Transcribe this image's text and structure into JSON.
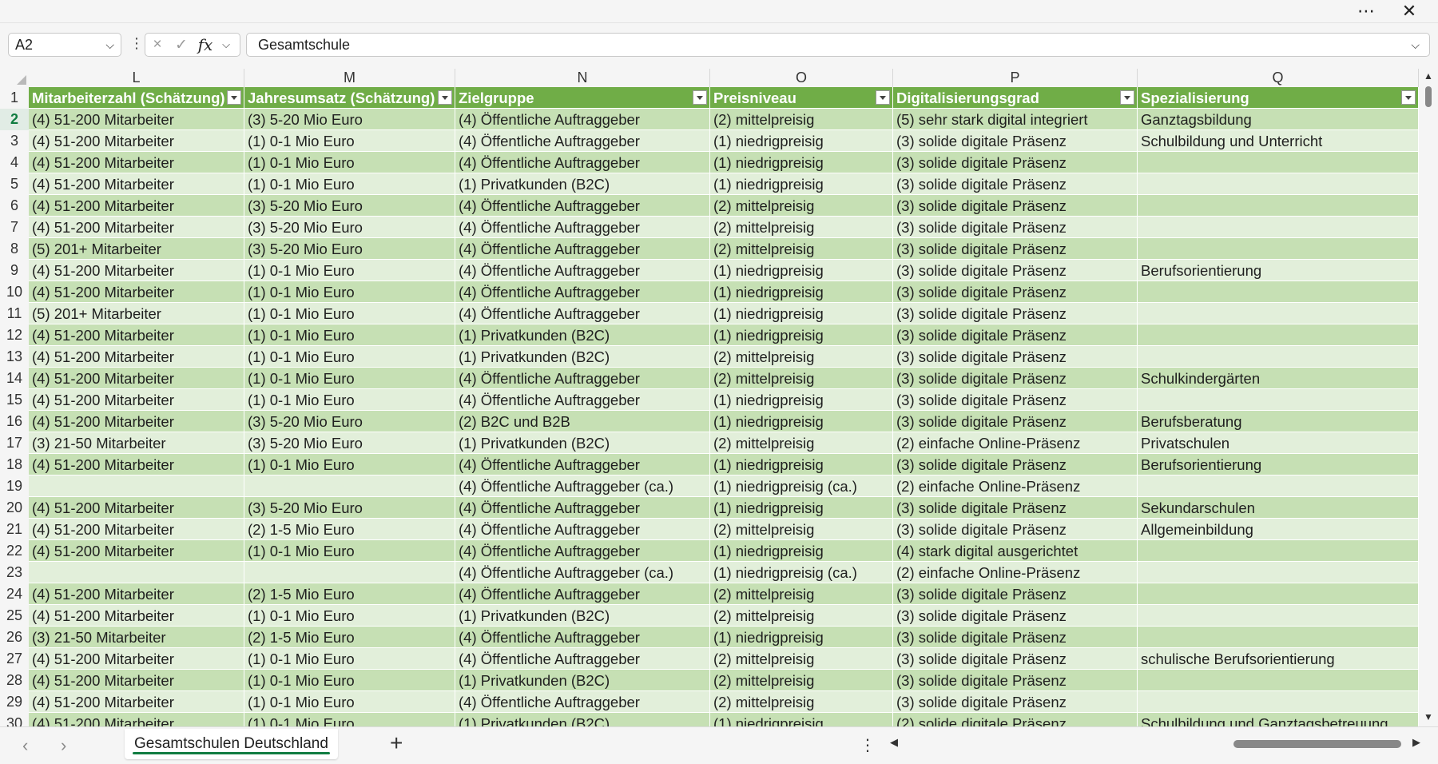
{
  "window": {
    "more_icon": "ellipsis-icon",
    "close_icon": "close-icon"
  },
  "formula_bar": {
    "name_box": "A2",
    "cancel_icon": "×",
    "enter_icon": "✓",
    "fx_label": "fx",
    "formula_value": "Gesamtschule"
  },
  "columns": [
    {
      "letter": "L",
      "header": "Mitarbeiterzahl (Schätzung)"
    },
    {
      "letter": "M",
      "header": "Jahresumsatz (Schätzung)"
    },
    {
      "letter": "N",
      "header": "Zielgruppe"
    },
    {
      "letter": "O",
      "header": "Preisniveau"
    },
    {
      "letter": "P",
      "header": "Digitalisierungsgrad"
    },
    {
      "letter": "Q",
      "header": "Spezialisierung"
    }
  ],
  "header_row_number": "1",
  "rows": [
    {
      "n": "2",
      "cells": [
        "(4) 51-200 Mitarbeiter",
        "(3) 5-20 Mio Euro",
        "(4) Öffentliche Auftraggeber",
        "(2) mittelpreisig",
        "(5) sehr stark digital integriert",
        "Ganztagsbildung"
      ]
    },
    {
      "n": "3",
      "cells": [
        "(4) 51-200 Mitarbeiter",
        "(1) 0-1 Mio Euro",
        "(4) Öffentliche Auftraggeber",
        "(1) niedrigpreisig",
        "(3) solide digitale Präsenz",
        "Schulbildung und Unterricht"
      ]
    },
    {
      "n": "4",
      "cells": [
        "(4) 51-200 Mitarbeiter",
        "(1) 0-1 Mio Euro",
        "(4) Öffentliche Auftraggeber",
        "(1) niedrigpreisig",
        "(3) solide digitale Präsenz",
        ""
      ]
    },
    {
      "n": "5",
      "cells": [
        "(4) 51-200 Mitarbeiter",
        "(1) 0-1 Mio Euro",
        "(1) Privatkunden (B2C)",
        "(1) niedrigpreisig",
        "(3) solide digitale Präsenz",
        ""
      ]
    },
    {
      "n": "6",
      "cells": [
        "(4) 51-200 Mitarbeiter",
        "(3) 5-20 Mio Euro",
        "(4) Öffentliche Auftraggeber",
        "(2) mittelpreisig",
        "(3) solide digitale Präsenz",
        ""
      ]
    },
    {
      "n": "7",
      "cells": [
        "(4) 51-200 Mitarbeiter",
        "(3) 5-20 Mio Euro",
        "(4) Öffentliche Auftraggeber",
        "(2) mittelpreisig",
        "(3) solide digitale Präsenz",
        ""
      ]
    },
    {
      "n": "8",
      "cells": [
        "(5) 201+ Mitarbeiter",
        "(3) 5-20 Mio Euro",
        "(4) Öffentliche Auftraggeber",
        "(2) mittelpreisig",
        "(3) solide digitale Präsenz",
        ""
      ]
    },
    {
      "n": "9",
      "cells": [
        "(4) 51-200 Mitarbeiter",
        "(1) 0-1 Mio Euro",
        "(4) Öffentliche Auftraggeber",
        "(1) niedrigpreisig",
        "(3) solide digitale Präsenz",
        "Berufsorientierung"
      ]
    },
    {
      "n": "10",
      "cells": [
        "(4) 51-200 Mitarbeiter",
        "(1) 0-1 Mio Euro",
        "(4) Öffentliche Auftraggeber",
        "(1) niedrigpreisig",
        "(3) solide digitale Präsenz",
        ""
      ]
    },
    {
      "n": "11",
      "cells": [
        "(5) 201+ Mitarbeiter",
        "(1) 0-1 Mio Euro",
        "(4) Öffentliche Auftraggeber",
        "(1) niedrigpreisig",
        "(3) solide digitale Präsenz",
        ""
      ]
    },
    {
      "n": "12",
      "cells": [
        "(4) 51-200 Mitarbeiter",
        "(1) 0-1 Mio Euro",
        "(1) Privatkunden (B2C)",
        "(1) niedrigpreisig",
        "(3) solide digitale Präsenz",
        ""
      ]
    },
    {
      "n": "13",
      "cells": [
        "(4) 51-200 Mitarbeiter",
        "(1) 0-1 Mio Euro",
        "(1) Privatkunden (B2C)",
        "(2) mittelpreisig",
        "(3) solide digitale Präsenz",
        ""
      ]
    },
    {
      "n": "14",
      "cells": [
        "(4) 51-200 Mitarbeiter",
        "(1) 0-1 Mio Euro",
        "(4) Öffentliche Auftraggeber",
        "(2) mittelpreisig",
        "(3) solide digitale Präsenz",
        "Schulkindergärten"
      ]
    },
    {
      "n": "15",
      "cells": [
        "(4) 51-200 Mitarbeiter",
        "(1) 0-1 Mio Euro",
        "(4) Öffentliche Auftraggeber",
        "(1) niedrigpreisig",
        "(3) solide digitale Präsenz",
        ""
      ]
    },
    {
      "n": "16",
      "cells": [
        "(4) 51-200 Mitarbeiter",
        "(3) 5-20 Mio Euro",
        "(2) B2C und B2B",
        "(1) niedrigpreisig",
        "(3) solide digitale Präsenz",
        "Berufsberatung"
      ]
    },
    {
      "n": "17",
      "cells": [
        "(3) 21-50 Mitarbeiter",
        "(3) 5-20 Mio Euro",
        "(1) Privatkunden (B2C)",
        "(2) mittelpreisig",
        "(2) einfache Online-Präsenz",
        "Privatschulen"
      ]
    },
    {
      "n": "18",
      "cells": [
        "(4) 51-200 Mitarbeiter",
        "(1) 0-1 Mio Euro",
        "(4) Öffentliche Auftraggeber",
        "(1) niedrigpreisig",
        "(3) solide digitale Präsenz",
        "Berufsorientierung"
      ]
    },
    {
      "n": "19",
      "cells": [
        "",
        "",
        "(4) Öffentliche Auftraggeber (ca.)",
        "(1) niedrigpreisig (ca.)",
        "(2) einfache Online-Präsenz",
        ""
      ]
    },
    {
      "n": "20",
      "cells": [
        "(4) 51-200 Mitarbeiter",
        "(3) 5-20 Mio Euro",
        "(4) Öffentliche Auftraggeber",
        "(1) niedrigpreisig",
        "(3) solide digitale Präsenz",
        "Sekundarschulen"
      ]
    },
    {
      "n": "21",
      "cells": [
        "(4) 51-200 Mitarbeiter",
        "(2) 1-5 Mio Euro",
        "(4) Öffentliche Auftraggeber",
        "(2) mittelpreisig",
        "(3) solide digitale Präsenz",
        "Allgemeinbildung"
      ]
    },
    {
      "n": "22",
      "cells": [
        "(4) 51-200 Mitarbeiter",
        "(1) 0-1 Mio Euro",
        "(4) Öffentliche Auftraggeber",
        "(1) niedrigpreisig",
        "(4) stark digital ausgerichtet",
        ""
      ]
    },
    {
      "n": "23",
      "cells": [
        "",
        "",
        "(4) Öffentliche Auftraggeber (ca.)",
        "(1) niedrigpreisig (ca.)",
        "(2) einfache Online-Präsenz",
        ""
      ]
    },
    {
      "n": "24",
      "cells": [
        "(4) 51-200 Mitarbeiter",
        "(2) 1-5 Mio Euro",
        "(4) Öffentliche Auftraggeber",
        "(2) mittelpreisig",
        "(3) solide digitale Präsenz",
        ""
      ]
    },
    {
      "n": "25",
      "cells": [
        "(4) 51-200 Mitarbeiter",
        "(1) 0-1 Mio Euro",
        "(1) Privatkunden (B2C)",
        "(2) mittelpreisig",
        "(3) solide digitale Präsenz",
        ""
      ]
    },
    {
      "n": "26",
      "cells": [
        "(3) 21-50 Mitarbeiter",
        "(2) 1-5 Mio Euro",
        "(4) Öffentliche Auftraggeber",
        "(1) niedrigpreisig",
        "(3) solide digitale Präsenz",
        ""
      ]
    },
    {
      "n": "27",
      "cells": [
        "(4) 51-200 Mitarbeiter",
        "(1) 0-1 Mio Euro",
        "(4) Öffentliche Auftraggeber",
        "(2) mittelpreisig",
        "(3) solide digitale Präsenz",
        "schulische Berufsorientierung"
      ]
    },
    {
      "n": "28",
      "cells": [
        "(4) 51-200 Mitarbeiter",
        "(1) 0-1 Mio Euro",
        "(1) Privatkunden (B2C)",
        "(2) mittelpreisig",
        "(3) solide digitale Präsenz",
        ""
      ]
    },
    {
      "n": "29",
      "cells": [
        "(4) 51-200 Mitarbeiter",
        "(1) 0-1 Mio Euro",
        "(4) Öffentliche Auftraggeber",
        "(2) mittelpreisig",
        "(3) solide digitale Präsenz",
        ""
      ]
    },
    {
      "n": "30",
      "cells": [
        "(4) 51-200 Mitarbeiter",
        "(1) 0-1 Mio Euro",
        "(1) Privatkunden (B2C)",
        "(1) niedrigpreisig",
        "(2) solide digitale Präsenz",
        "Schulbildung und Ganztagsbetreuung"
      ]
    }
  ],
  "sheet_tabs": {
    "active": "Gesamtschulen Deutschland",
    "add_label": "+"
  },
  "colors": {
    "header_green": "#70ad47",
    "band_dark": "#c6e0b4",
    "band_light": "#e2efda",
    "accent": "#107c41"
  }
}
